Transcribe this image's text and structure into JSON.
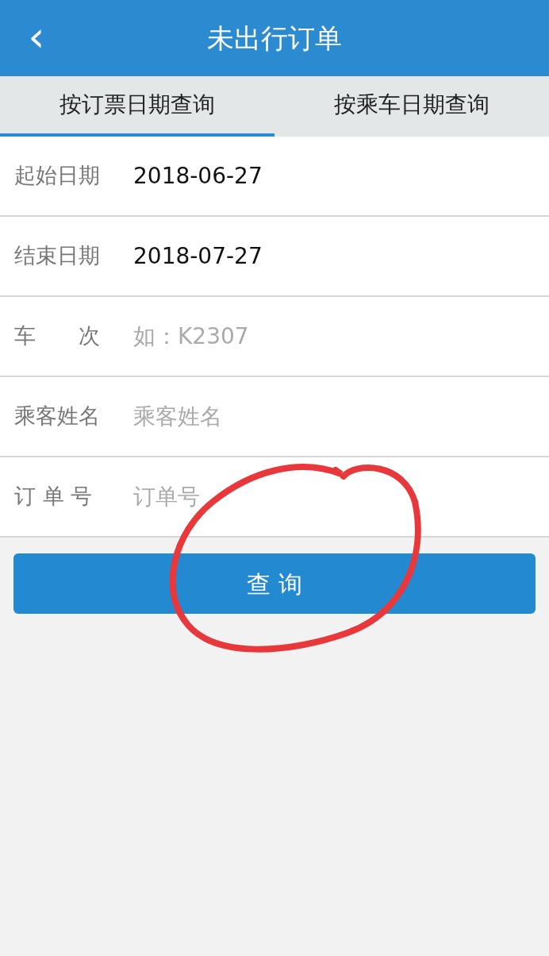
{
  "header": {
    "back_icon": "‹",
    "title": "未出行订单"
  },
  "tabs": [
    {
      "label": "按订票日期查询",
      "selected": true
    },
    {
      "label": "按乘车日期查询",
      "selected": false
    }
  ],
  "fields": [
    {
      "label": "起始日期",
      "value": "2018-06-27"
    },
    {
      "label": "结束日期",
      "value": "2018-07-27"
    },
    {
      "label": "车　　次",
      "placeholder": "如：K2307"
    },
    {
      "label": "乘客姓名",
      "placeholder": "乘客姓名"
    },
    {
      "label": "订 单 号",
      "placeholder": "订单号"
    }
  ],
  "button": "查 询"
}
